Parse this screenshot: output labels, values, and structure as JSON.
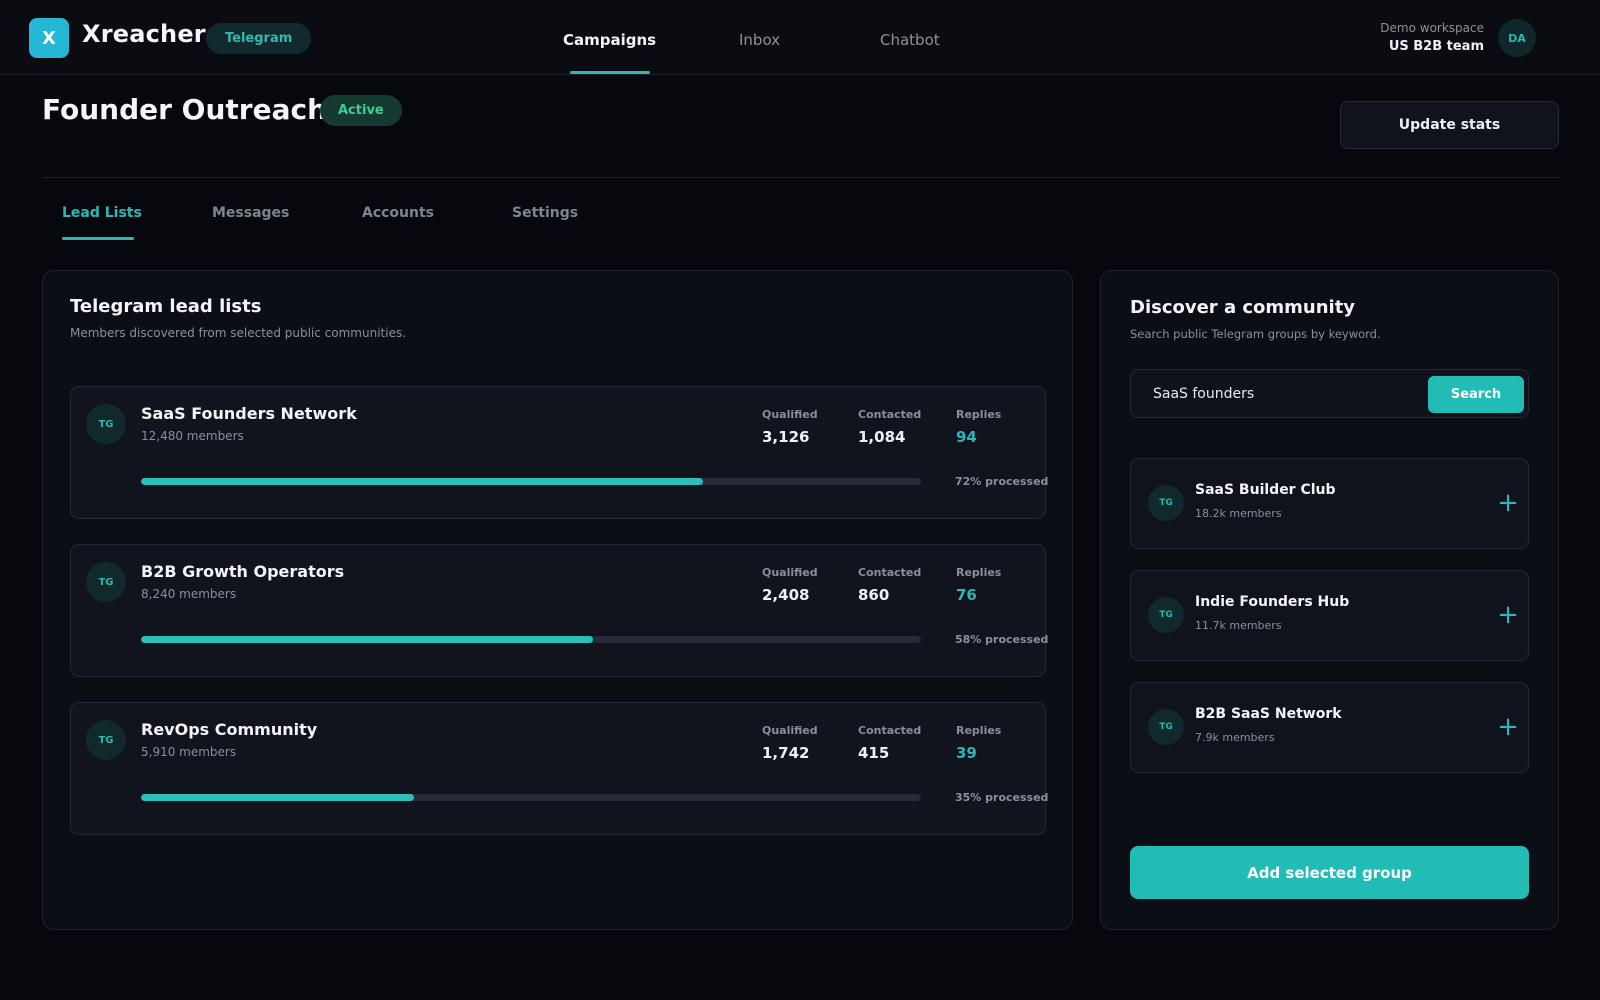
{
  "brand": {
    "logo_letter": "X",
    "name": "Xreacher",
    "channel_badge": "Telegram"
  },
  "nav": {
    "items": [
      {
        "label": "Campaigns",
        "active": true
      },
      {
        "label": "Inbox",
        "active": false
      },
      {
        "label": "Chatbot",
        "active": false
      }
    ]
  },
  "workspace": {
    "label": "Demo workspace",
    "name": "US B2B team",
    "avatar_initials": "DA"
  },
  "page": {
    "title": "Founder Outreach",
    "status": "Active",
    "update_button": "Update stats"
  },
  "tabs": [
    {
      "label": "Lead Lists",
      "active": true
    },
    {
      "label": "Messages",
      "active": false
    },
    {
      "label": "Accounts",
      "active": false
    },
    {
      "label": "Settings",
      "active": false
    }
  ],
  "lead_panel": {
    "title": "Telegram lead lists",
    "subtitle": "Members discovered from selected public communities.",
    "stat_labels": {
      "qualified": "Qualified",
      "contacted": "Contacted",
      "replies": "Replies"
    },
    "lists": [
      {
        "avatar": "TG",
        "name": "SaaS Founders Network",
        "members": "12,480 members",
        "qualified": "3,126",
        "contacted": "1,084",
        "replies": "94",
        "progress": 72,
        "progress_text": "72% processed"
      },
      {
        "avatar": "TG",
        "name": "B2B Growth Operators",
        "members": "8,240 members",
        "qualified": "2,408",
        "contacted": "860",
        "replies": "76",
        "progress": 58,
        "progress_text": "58% processed"
      },
      {
        "avatar": "TG",
        "name": "RevOps Community",
        "members": "5,910 members",
        "qualified": "1,742",
        "contacted": "415",
        "replies": "39",
        "progress": 35,
        "progress_text": "35% processed"
      }
    ]
  },
  "discover_panel": {
    "title": "Discover a community",
    "subtitle": "Search public Telegram groups by keyword.",
    "search": {
      "value": "SaaS founders",
      "button": "Search"
    },
    "communities": [
      {
        "avatar": "TG",
        "name": "SaaS Builder Club",
        "members": "18.2k members",
        "icon": "plus-icon"
      },
      {
        "avatar": "TG",
        "name": "Indie Founders Hub",
        "members": "11.7k members",
        "icon": "plus-icon"
      },
      {
        "avatar": "TG",
        "name": "B2B SaaS Network",
        "members": "7.9k members",
        "icon": "plus-icon"
      }
    ],
    "add_button": "Add selected group"
  },
  "colors": {
    "accent": "#2cb8b4",
    "background": "#07080d",
    "status_active": "#3ccf9a"
  }
}
